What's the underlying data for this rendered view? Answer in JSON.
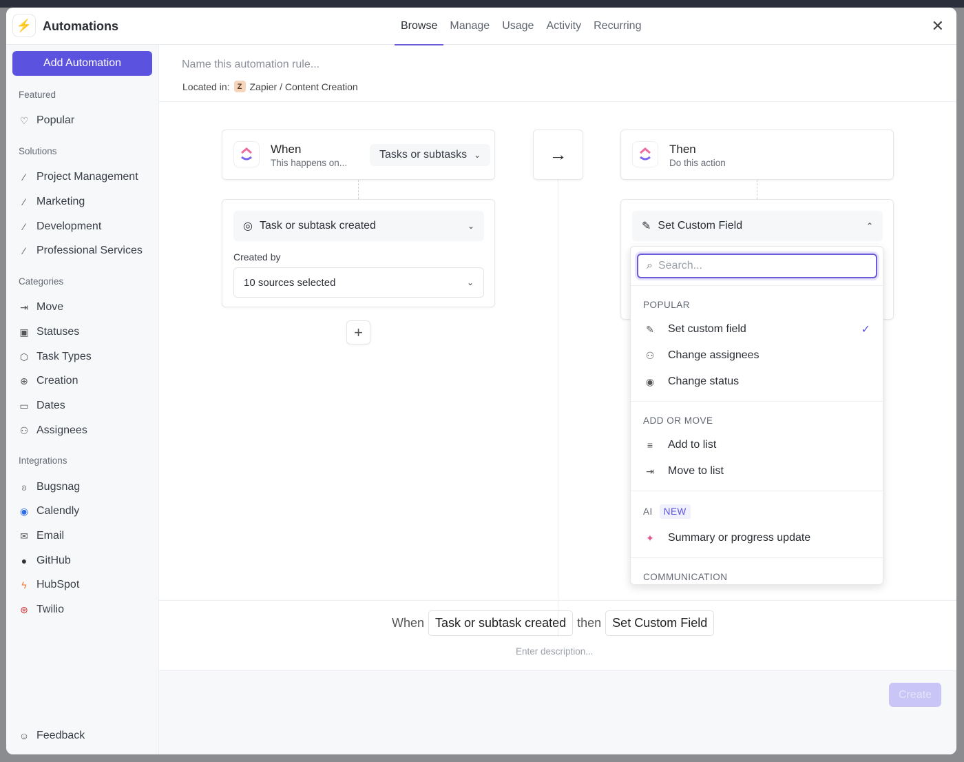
{
  "header": {
    "title": "Automations",
    "tabs": [
      "Browse",
      "Manage",
      "Usage",
      "Activity",
      "Recurring"
    ],
    "active_tab": "Browse"
  },
  "sidebar": {
    "add_button": "Add Automation",
    "sections": [
      {
        "title": "Featured",
        "items": [
          {
            "label": "Popular",
            "icon": "heart-icon"
          }
        ]
      },
      {
        "title": "Solutions",
        "items": [
          {
            "label": "Project Management",
            "icon": "wand-icon"
          },
          {
            "label": "Marketing",
            "icon": "wand-icon"
          },
          {
            "label": "Development",
            "icon": "wand-icon"
          },
          {
            "label": "Professional Services",
            "icon": "wand-icon"
          }
        ]
      },
      {
        "title": "Categories",
        "items": [
          {
            "label": "Move",
            "icon": "move-icon"
          },
          {
            "label": "Statuses",
            "icon": "status-icon"
          },
          {
            "label": "Task Types",
            "icon": "cube-icon"
          },
          {
            "label": "Creation",
            "icon": "plus-circle-icon"
          },
          {
            "label": "Dates",
            "icon": "calendar-icon"
          },
          {
            "label": "Assignees",
            "icon": "users-icon"
          }
        ]
      },
      {
        "title": "Integrations",
        "items": [
          {
            "label": "Bugsnag",
            "icon": "bugsnag-icon"
          },
          {
            "label": "Calendly",
            "icon": "calendly-icon"
          },
          {
            "label": "Email",
            "icon": "mail-icon"
          },
          {
            "label": "GitHub",
            "icon": "github-icon"
          },
          {
            "label": "HubSpot",
            "icon": "hubspot-icon"
          },
          {
            "label": "Twilio",
            "icon": "twilio-icon"
          }
        ]
      }
    ],
    "feedback": "Feedback"
  },
  "rule": {
    "name_placeholder": "Name this automation rule...",
    "located_label": "Located in:",
    "location_badge": "Z",
    "location": "Zapier / Content Creation"
  },
  "trigger": {
    "title": "When",
    "subtitle": "This happens on...",
    "scope": "Tasks or subtasks",
    "event": "Task or subtask created",
    "created_by_label": "Created by",
    "created_by_value": "10 sources selected"
  },
  "action": {
    "title": "Then",
    "subtitle": "Do this action",
    "selected": "Set Custom Field"
  },
  "dropdown": {
    "search_placeholder": "Search...",
    "popular_title": "POPULAR",
    "popular": [
      "Set custom field",
      "Change assignees",
      "Change status"
    ],
    "addmove_title": "ADD OR MOVE",
    "addmove": [
      "Add to list",
      "Move to list"
    ],
    "ai_title": "AI",
    "ai_badge": "NEW",
    "ai": [
      "Summary or progress update"
    ],
    "communication_title": "COMMUNICATION"
  },
  "summary": {
    "when": "When",
    "trigger": "Task or subtask created",
    "then": "then",
    "action": "Set Custom Field",
    "description_placeholder": "Enter description..."
  },
  "footer": {
    "create": "Create"
  },
  "colors": {
    "accent": "#5b52e0",
    "create_disabled": "#c9c5f6"
  }
}
